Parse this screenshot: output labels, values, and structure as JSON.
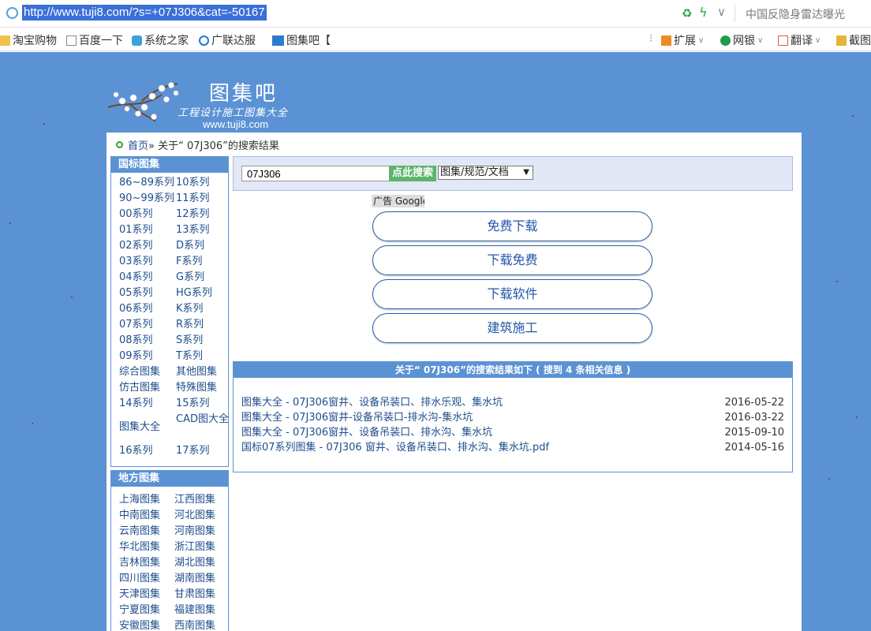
{
  "browser": {
    "url": "http://www.tuji8.com/?s=+07J306&cat=-50167",
    "news_text": "中国反隐身雷达曝光",
    "bookmarks": [
      "淘宝购物",
      "百度一下",
      "系统之家",
      "广联达服",
      "图集吧【"
    ],
    "right_tools": [
      "扩展",
      "网银",
      "翻译",
      "截图"
    ]
  },
  "logo": {
    "title": "图集吧",
    "subtitle": "工程设计施工图集大全",
    "site": "www.tuji8.com"
  },
  "breadcrumb": {
    "home": "首页",
    "rest": " » 关于“ 07J306”的搜索结果"
  },
  "sidebar": {
    "guobiao_title": "国标图集",
    "guobiao_items": [
      "86~89系列",
      "10系列",
      "90~99系列",
      "11系列",
      "00系列",
      "12系列",
      "01系列",
      "13系列",
      "02系列",
      "D系列",
      "03系列",
      "F系列",
      "04系列",
      "G系列",
      "05系列",
      "HG系列",
      "06系列",
      "K系列",
      "07系列",
      "R系列",
      "08系列",
      "S系列",
      "09系列",
      "T系列",
      "综合图集",
      "其他图集",
      "仿古图集",
      "特殊图集",
      "14系列",
      "15系列",
      "图集大全",
      "CAD图大全",
      "16系列",
      "17系列"
    ],
    "difang_title": "地方图集",
    "difang_items": [
      "上海图集",
      "江西图集",
      "中南图集",
      "河北图集",
      "云南图集",
      "河南图集",
      "华北图集",
      "浙江图集",
      "吉林图集",
      "湖北图集",
      "四川图集",
      "湖南图集",
      "天津图集",
      "甘肃图集",
      "宁夏图集",
      "福建图集",
      "安徽图集",
      "西南图集"
    ]
  },
  "search": {
    "value": "07J306",
    "button": "点此搜索",
    "select_value": "图集/规范/文档"
  },
  "ads": {
    "label": "广告 Google",
    "buttons": [
      "免费下载",
      "下载免费",
      "下载软件",
      "建筑施工"
    ]
  },
  "results": {
    "header": "关于“ 07J306”的搜索结果如下 ( 搜到 4 条相关信息 )",
    "items": [
      {
        "title": "图集大全 - 07J306窗井、设备吊装口、排水乐观、集水坑",
        "date": "2016-05-22"
      },
      {
        "title": "图集大全 - 07J306窗井-设备吊装口-排水沟-集水坑",
        "date": "2016-03-22"
      },
      {
        "title": "图集大全 - 07J306窗井、设备吊装口、排水沟、集水坑",
        "date": "2015-09-10"
      },
      {
        "title": "国标07系列图集 - 07J306 窗井、设备吊装口、排水沟、集水坑.pdf",
        "date": "2014-05-16"
      }
    ]
  },
  "colors": {
    "page_bg": "#5b92d4",
    "link": "#1e4d8c",
    "search_btn": "#5cb56a"
  }
}
